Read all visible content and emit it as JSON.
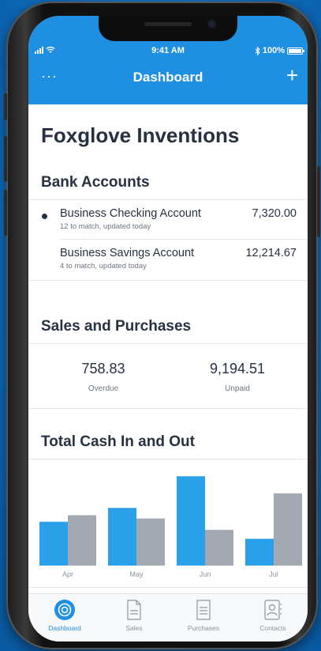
{
  "status_bar": {
    "time": "9:41 AM",
    "battery": "100%",
    "battery_level": 1.0
  },
  "nav": {
    "title": "Dashboard",
    "more_label": "···",
    "add_label": "+"
  },
  "company_name": "Foxglove Inventions",
  "bank_accounts": {
    "title": "Bank Accounts",
    "items": [
      {
        "name": "Business Checking Account",
        "subtitle": "12 to match, updated today",
        "amount": "7,320.00",
        "selected": true
      },
      {
        "name": "Business Savings Account",
        "subtitle": "4 to match, updated today",
        "amount": "12,214.67",
        "selected": false
      }
    ]
  },
  "sales_purchases": {
    "title": "Sales and Purchases",
    "overdue": {
      "value": "758.83",
      "label": "Overdue"
    },
    "unpaid": {
      "value": "9,194.51",
      "label": "Unpaid"
    }
  },
  "cash_chart": {
    "title": "Total Cash In and Out"
  },
  "chart_data": {
    "type": "bar",
    "categories": [
      "Apr",
      "May",
      "Jun",
      "Jul"
    ],
    "series": [
      {
        "values": [
          54,
          71,
          110,
          33
        ],
        "color": "#2aa1ea"
      },
      {
        "values": [
          62,
          58,
          44,
          89
        ],
        "color": "#a3a9b2"
      }
    ],
    "ylim": [
      0,
      115
    ],
    "grid": false,
    "legend": "none"
  },
  "tabs": [
    {
      "label": "Dashboard",
      "icon": "dashboard-icon",
      "active": true
    },
    {
      "label": "Sales",
      "icon": "sales-document-icon",
      "active": false
    },
    {
      "label": "Purchases",
      "icon": "purchases-document-icon",
      "active": false
    },
    {
      "label": "Contacts",
      "icon": "contacts-icon",
      "active": false
    }
  ],
  "colors": {
    "brand_blue": "#1e8fe1",
    "text_dark": "#273142",
    "bar_blue": "#2aa1ea",
    "bar_gray": "#a3a9b2"
  }
}
